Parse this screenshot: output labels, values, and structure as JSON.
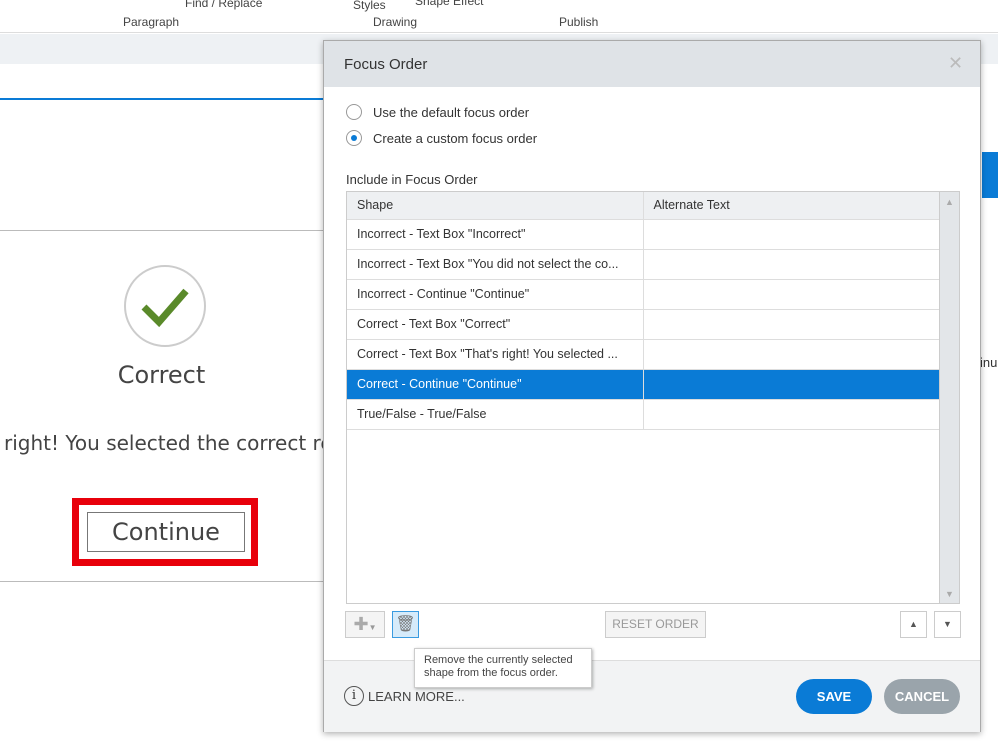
{
  "ribbon": {
    "find_replace": "Find / Replace",
    "styles": "Styles",
    "shape_effect": "Shape Effect",
    "groups": [
      "Paragraph",
      "Drawing",
      "Publish"
    ]
  },
  "slide": {
    "heading": "Correct",
    "message": "right!  You selected the correct res",
    "button": "Continue",
    "side_text": "inu"
  },
  "dialog": {
    "title": "Focus Order",
    "options": [
      {
        "label": "Use the default focus order",
        "selected": false
      },
      {
        "label": "Create a custom focus order",
        "selected": true
      }
    ],
    "include_label": "Include in Focus Order",
    "columns": [
      "Shape",
      "Alternate Text"
    ],
    "rows": [
      {
        "shape": "Incorrect - Text Box \"Incorrect\"",
        "alt": ""
      },
      {
        "shape": "Incorrect - Text Box \"You did not select the co...",
        "alt": ""
      },
      {
        "shape": "Incorrect - Continue \"Continue\"",
        "alt": ""
      },
      {
        "shape": "Correct - Text Box \"Correct\"",
        "alt": ""
      },
      {
        "shape": "Correct - Text Box \"That's right!  You selected ...",
        "alt": ""
      },
      {
        "shape": "Correct - Continue \"Continue\"",
        "alt": "",
        "selected": true
      },
      {
        "shape": "True/False - True/False",
        "alt": ""
      }
    ],
    "reset_order": "RESET ORDER",
    "tooltip": "Remove the currently selected shape from the focus order.",
    "learn_more": "LEARN MORE...",
    "save": "SAVE",
    "cancel": "CANCEL"
  },
  "colors": {
    "accent": "#0a7bd6",
    "cancel": "#9aa4ab",
    "highlight": "#e8000b",
    "check": "#5a8a2a"
  }
}
